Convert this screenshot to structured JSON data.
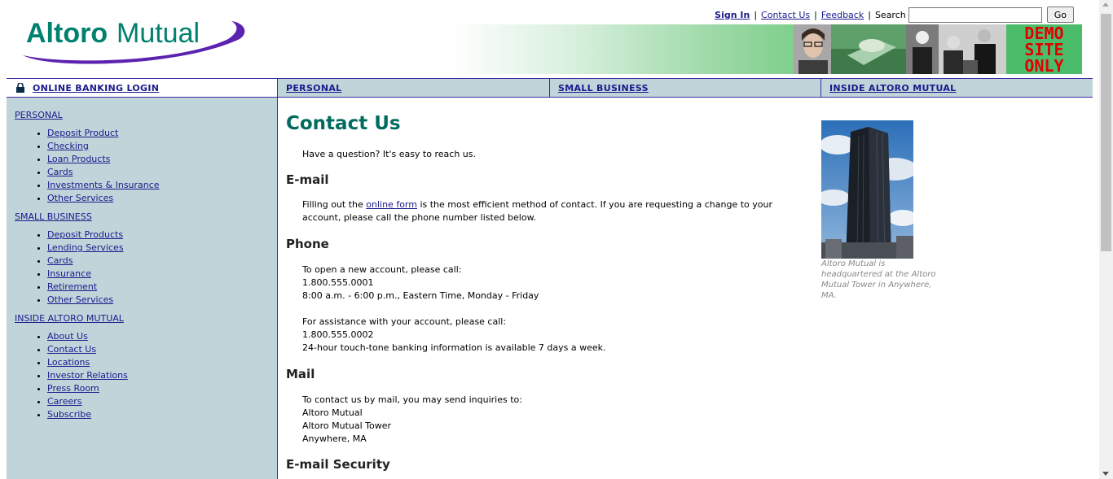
{
  "brand": {
    "logo_text_dark": "Altoro",
    "logo_text_light": "Mutual",
    "accent": "#00806e",
    "swoosh": "#5b23b0"
  },
  "toplinks": {
    "sign_in": "Sign In",
    "contact_us": "Contact Us",
    "feedback": "Feedback",
    "search_label": "Search",
    "search_value": "",
    "go": "Go",
    "sep": "|"
  },
  "banner": {
    "demo_line1": "DEMO",
    "demo_line2": "SITE",
    "demo_line3": "ONLY"
  },
  "nav": {
    "login": "ONLINE BANKING LOGIN",
    "personal": "PERSONAL",
    "small_business": "SMALL BUSINESS",
    "inside": "INSIDE ALTORO MUTUAL"
  },
  "sidebar": {
    "sections": [
      {
        "title": "PERSONAL",
        "items": [
          "Deposit Product",
          "Checking",
          "Loan Products",
          "Cards",
          "Investments & Insurance",
          "Other Services"
        ]
      },
      {
        "title": "SMALL BUSINESS",
        "items": [
          "Deposit Products",
          "Lending Services",
          "Cards",
          "Insurance",
          "Retirement",
          "Other Services"
        ]
      },
      {
        "title": "INSIDE ALTORO MUTUAL",
        "items": [
          "About Us",
          "Contact Us",
          "Locations",
          "Investor Relations",
          "Press Room",
          "Careers",
          "Subscribe"
        ]
      }
    ]
  },
  "main": {
    "title": "Contact Us",
    "intro": "Have a question? It's easy to reach us.",
    "email_head": "E-mail",
    "email_pre": "Filling out the ",
    "email_link": "online form",
    "email_post": " is the most efficient method of contact. If you are requesting a change to your account, please call the phone number listed below.",
    "phone_head": "Phone",
    "phone_new_1": "To open a new account, please call:",
    "phone_new_2": "1.800.555.0001",
    "phone_new_3": "8:00 a.m. - 6:00 p.m., Eastern Time, Monday - Friday",
    "phone_assist_1": "For assistance with your account, please call:",
    "phone_assist_2": "1.800.555.0002",
    "phone_assist_3": "24-hour touch-tone banking information is available 7 days a week.",
    "mail_head": "Mail",
    "mail_1": "To contact us by mail, you may send inquiries to:",
    "mail_2": "Altoro Mutual",
    "mail_3": "Altoro Mutual Tower",
    "mail_4": "Anywhere, MA",
    "security_head": "E-mail Security"
  },
  "caption": "Altoro Mutual is headquartered at the Altoro Mutual Tower in Anywhere, MA."
}
